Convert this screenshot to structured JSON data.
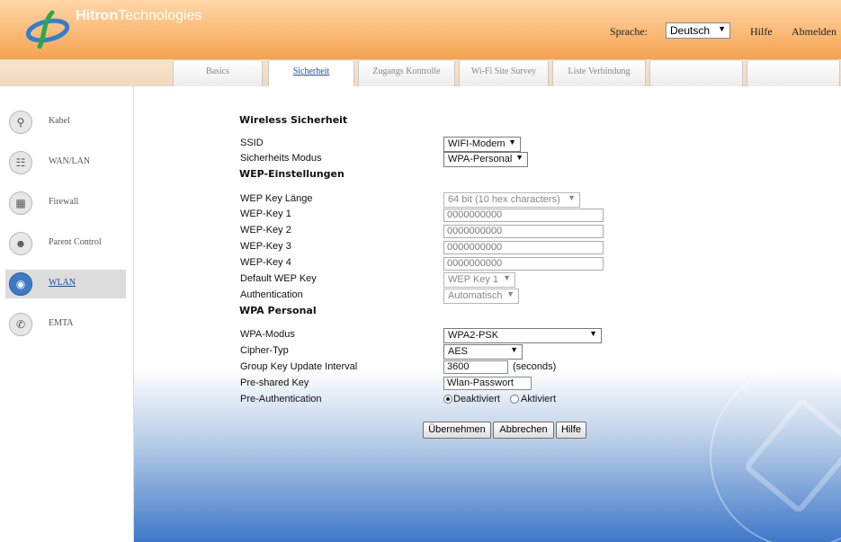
{
  "header": {
    "brand_bold": "Hitron",
    "brand_light": "Technologies",
    "language_label": "Sprache:",
    "language_value": "Deutsch",
    "help_link": "Hilfe",
    "logout_link": "Abmelden"
  },
  "tabs": [
    {
      "label": "Basics",
      "active": false
    },
    {
      "label": "Sicherheit",
      "active": true
    },
    {
      "label": "Zugangs Kontrolle",
      "active": false
    },
    {
      "label": "Wi-Fi Site Survey",
      "active": false
    },
    {
      "label": "Liste Verbindung",
      "active": false
    },
    {
      "label": "",
      "active": false
    },
    {
      "label": "",
      "active": false
    }
  ],
  "sidebar": {
    "items": [
      {
        "label": "Kabel",
        "icon": "wrench-icon",
        "active": false
      },
      {
        "label": "WAN/LAN",
        "icon": "network-icon",
        "active": false
      },
      {
        "label": "Firewall",
        "icon": "firewall-icon",
        "active": false
      },
      {
        "label": "Parent Control",
        "icon": "users-icon",
        "active": false
      },
      {
        "label": "WLAN",
        "icon": "wifi-icon",
        "active": true
      },
      {
        "label": "EMTA",
        "icon": "phone-icon",
        "active": false
      }
    ]
  },
  "form": {
    "title": "Wireless Sicherheit",
    "ssid_label": "SSID",
    "ssid_value": "WIFI-Modem",
    "mode_label": "Sicherheits Modus",
    "mode_value": "WPA-Personal",
    "wep_section": "WEP-Einstellungen",
    "wep_len_label": "WEP Key Länge",
    "wep_len_value": "64 bit (10 hex characters)",
    "wep_key1_label": "WEP-Key 1",
    "wep_key1_value": "0000000000",
    "wep_key2_label": "WEP-Key 2",
    "wep_key2_value": "0000000000",
    "wep_key3_label": "WEP-Key 3",
    "wep_key3_value": "0000000000",
    "wep_key4_label": "WEP-Key 4",
    "wep_key4_value": "0000000000",
    "default_wep_label": "Default WEP Key",
    "default_wep_value": "WEP Key 1",
    "auth_label": "Authentication",
    "auth_value": "Automatisch",
    "wpa_section": "WPA Personal",
    "wpa_mode_label": "WPA-Modus",
    "wpa_mode_value": "WPA2-PSK",
    "cipher_label": "Cipher-Typ",
    "cipher_value": "AES",
    "gkui_label": "Group Key Update Interval",
    "gkui_value": "3600",
    "gkui_unit": "(seconds)",
    "psk_label": "Pre-shared Key",
    "psk_value": "Wlan-Passwort",
    "preauth_label": "Pre-Authentication",
    "preauth_off": "Deaktiviert",
    "preauth_on": "Aktiviert",
    "preauth_selected": "Deaktiviert"
  },
  "buttons": {
    "apply": "Übernehmen",
    "cancel": "Abbrechen",
    "help": "Hilfe"
  }
}
